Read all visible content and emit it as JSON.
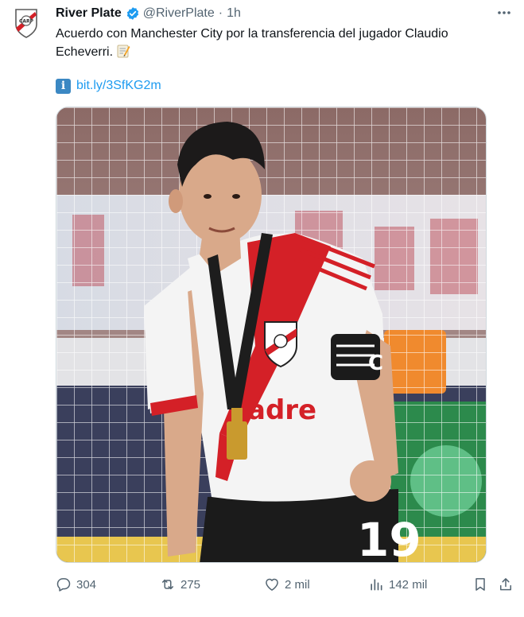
{
  "tweet": {
    "author_name": "River Plate",
    "handle": "@RiverPlate",
    "separator": "·",
    "time": "1h",
    "text": "Acuerdo con Manchester City por la transferencia del jugador Claudio Echeverri.",
    "link": "bit.ly/3SfKG2m",
    "link_icon": "information-emoji-icon",
    "memo_icon": "memo-emoji-icon"
  },
  "photo": {
    "alt": "Claudio Echeverri con la camiseta de River Plate y una medalla",
    "jersey_sponsor": "adre",
    "jersey_number": "19",
    "captain_band": "C"
  },
  "actions": {
    "replies": "304",
    "retweets": "275",
    "likes": "2 mil",
    "views": "142 mil"
  },
  "colors": {
    "link": "#1d9bf0",
    "muted": "#536471",
    "verified": "#1d9bf0",
    "river_red": "#d42027"
  }
}
